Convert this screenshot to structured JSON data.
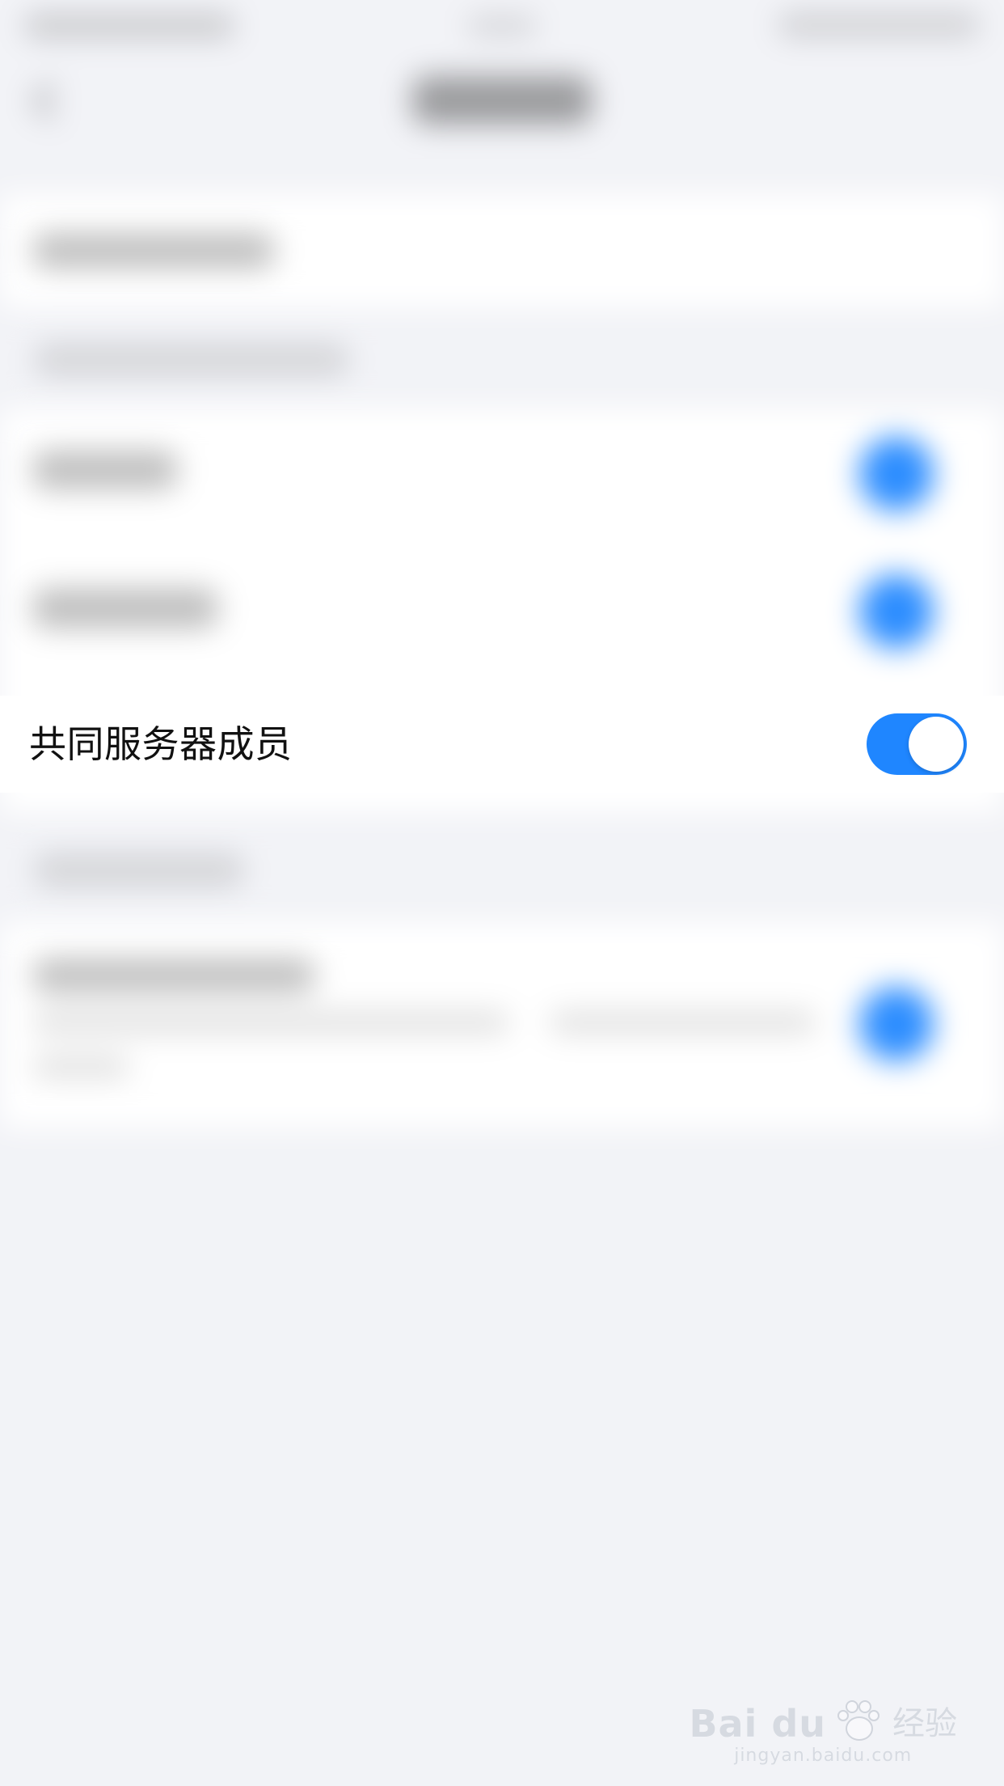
{
  "settings": {
    "focused_item": {
      "label": "共同服务器成员",
      "enabled": true
    }
  },
  "watermark": {
    "brand": "Bai du",
    "product": "经验",
    "url": "jingyan.baidu.com"
  },
  "colors": {
    "accent": "#1f86ff",
    "background": "#f2f3f7",
    "card": "#ffffff",
    "text": "#111111"
  },
  "icons": {
    "back": "chevron-left-icon",
    "toggle": "toggle-switch-icon",
    "watermark_logo": "paw-logo-icon"
  }
}
